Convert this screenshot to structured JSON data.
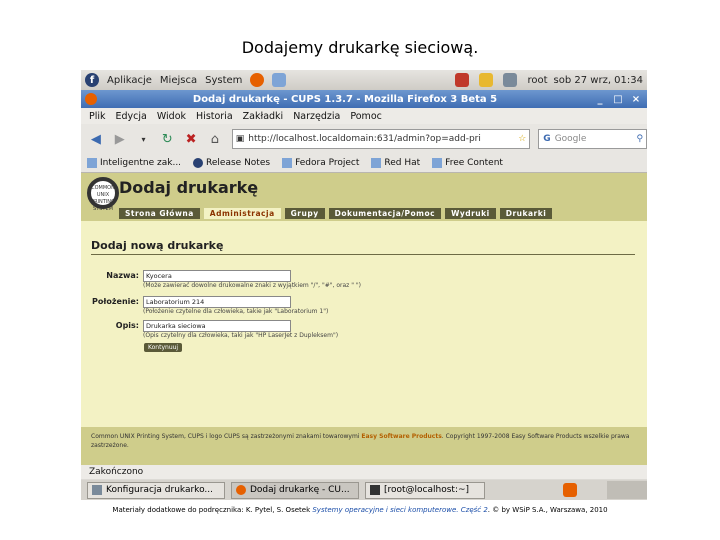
{
  "slide": {
    "title": "Dodajemy drukarkę sieciową.",
    "credits": {
      "before": "Materiały dodatkowe do podręcznika: K. Pytel, S. Osetek ",
      "book": "Systemy operacyjne i sieci komputerowe. Część 2",
      "after": ". © by WSiP S.A., Warszawa, 2010"
    }
  },
  "gnome_panel": {
    "menus": [
      "Aplikacje",
      "Miejsca",
      "System"
    ],
    "user": "root",
    "clock": "sob 27 wrz, 01:34"
  },
  "window": {
    "title": "Dodaj drukarkę - CUPS 1.3.7 - Mozilla Firefox 3 Beta 5",
    "controls": [
      "_",
      "□",
      "×"
    ]
  },
  "menubar": [
    "Plik",
    "Edycja",
    "Widok",
    "Historia",
    "Zakładki",
    "Narzędzia",
    "Pomoc"
  ],
  "navbar": {
    "url": "http://localhost.localdomain:631/admin?op=add-pri",
    "search_placeholder": "Google"
  },
  "bookmarks": [
    "Inteligentne zak...",
    "Release Notes",
    "Fedora Project",
    "Red Hat",
    "Free Content"
  ],
  "cups": {
    "title": "Dodaj drukarkę",
    "logo_text": "COMMON UNIX PRINTING SYSTEM",
    "tabs": [
      "Strona Główna",
      "Administracja",
      "Grupy",
      "Dokumentacja/Pomoc",
      "Wydruki",
      "Drukarki"
    ],
    "active_tab": "Administracja",
    "heading": "Dodaj nową drukarkę",
    "form": {
      "name_label": "Nazwa:",
      "name_value": "Kyocera",
      "name_hint": "(Może zawierać dowolne drukowalne znaki z wyjątkiem \"/\", \"#\", oraz \" \")",
      "location_label": "Położenie:",
      "location_value": "Laboratorium 214",
      "location_hint": "(Położenie czytelne dla człowieka, takie jak \"Laboratorium 1\")",
      "description_label": "Opis:",
      "description_value": "Drukarka sieciowa",
      "description_hint": "(Opis czytelny dla człowieka, taki jak \"HP LaserJet z Dupleksem\")",
      "continue_label": "Kontynuuj"
    },
    "footer": {
      "part1": "Common UNIX Printing System, CUPS i logo CUPS są zastrzeżonymi znakami towarowymi ",
      "brand": "Easy Software Products",
      "part2": ". Copyright 1997-2008 Easy Software Products wszelkie prawa zastrzeżone."
    }
  },
  "statusbar": "Zakończono",
  "taskbar": [
    "Konfiguracja drukarko...",
    "Dodaj drukarkę - CU...",
    "[root@localhost:~]"
  ]
}
